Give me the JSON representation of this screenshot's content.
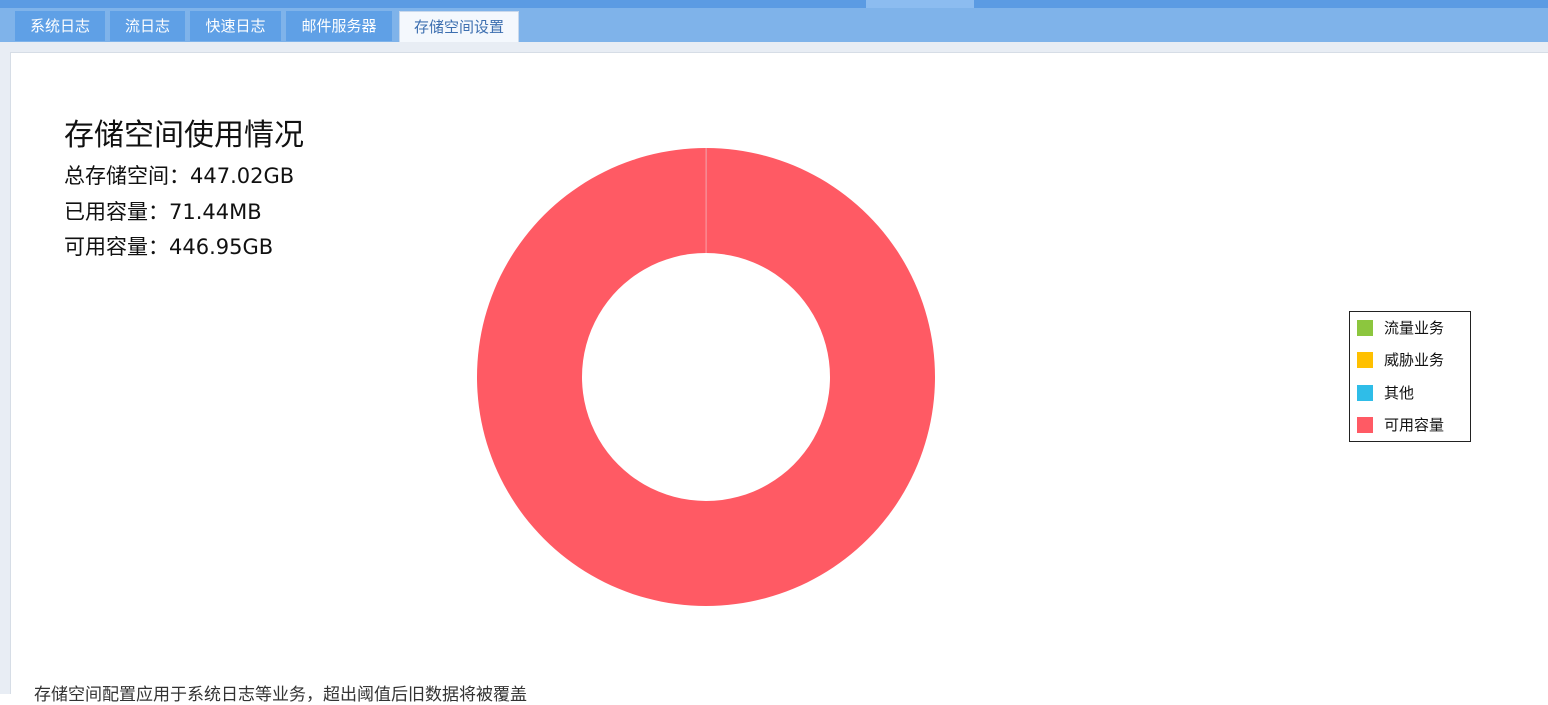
{
  "tabs": [
    {
      "label": "系统日志"
    },
    {
      "label": "流日志"
    },
    {
      "label": "快速日志"
    },
    {
      "label": "邮件服务器"
    },
    {
      "label": "存储空间设置"
    }
  ],
  "active_tab": "存储空间设置",
  "summary": {
    "title": "存储空间使用情况",
    "total": "总存储空间：447.02GB",
    "used": "已用容量：71.44MB",
    "available": "可用容量：446.95GB"
  },
  "colors": {
    "traffic": "#8cc63e",
    "threat": "#ffc000",
    "other": "#2fbde8",
    "available": "#ff5a64",
    "tab_bar": "#7fb3ea",
    "tab": "#5fa0e6"
  },
  "chart_data": {
    "type": "pie",
    "title": "",
    "categories": [
      "流量业务",
      "威胁业务",
      "其他",
      "可用容量"
    ],
    "values": [
      0.0,
      0.0,
      71.44,
      457676.8
    ],
    "unit": "MB",
    "legend_position": "right"
  },
  "legend": {
    "items": [
      {
        "label": "流量业务",
        "color": "#8cc63e"
      },
      {
        "label": "威胁业务",
        "color": "#ffc000"
      },
      {
        "label": "其他",
        "color": "#2fbde8"
      },
      {
        "label": "可用容量",
        "color": "#ff5a64"
      }
    ]
  },
  "bottom_note": "存储空间配置应用于系统日志等业务，超出阈值后旧数据将被覆盖"
}
